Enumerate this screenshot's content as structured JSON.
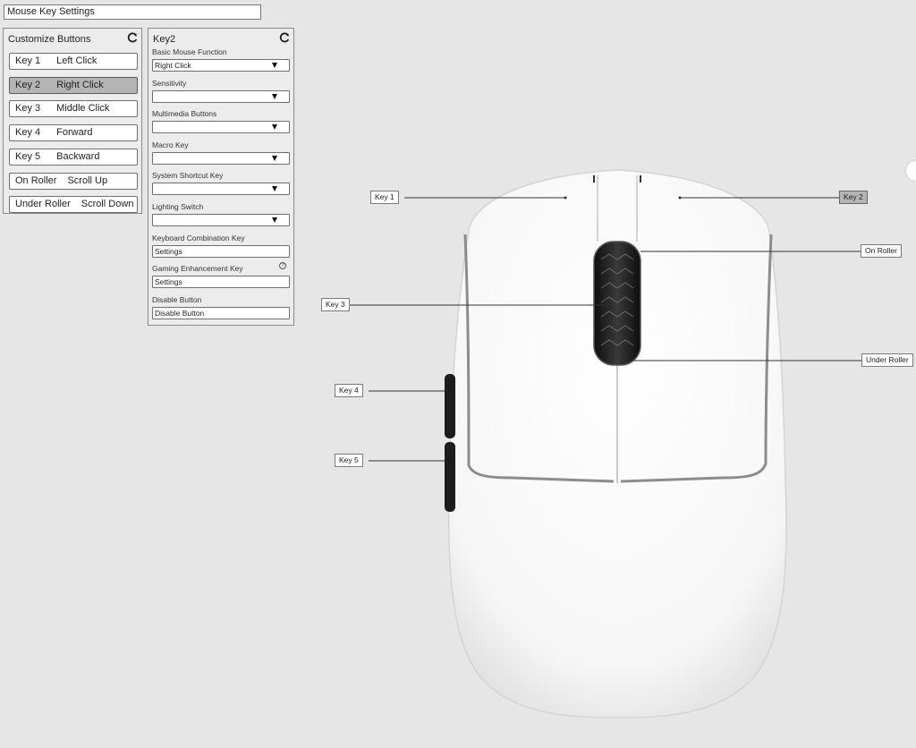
{
  "window": {
    "title": "Mouse Key Settings"
  },
  "customize": {
    "title": "Customize Buttons",
    "buttons": [
      {
        "key": "Key 1",
        "function": "Left Click",
        "active": false
      },
      {
        "key": "Key 2",
        "function": "Right Click",
        "active": true
      },
      {
        "key": "Key 3",
        "function": "Middle Click",
        "active": false
      },
      {
        "key": "Key 4",
        "function": "Forward",
        "active": false
      },
      {
        "key": "Key 5",
        "function": "Backward",
        "active": false
      },
      {
        "key": "On Roller",
        "function": "Scroll Up",
        "active": false
      },
      {
        "key": "Under Roller",
        "function": "Scroll Down",
        "active": false
      }
    ]
  },
  "detail": {
    "title": "Key2",
    "fields": [
      {
        "label": "Basic Mouse Function",
        "value": "Right Click",
        "type": "dropdown"
      },
      {
        "label": "Sensitivity",
        "value": "",
        "type": "dropdown"
      },
      {
        "label": "Multimedia Buttons",
        "value": "",
        "type": "dropdown"
      },
      {
        "label": "Macro Key",
        "value": "",
        "type": "dropdown"
      },
      {
        "label": "System Shortcut Key",
        "value": "",
        "type": "dropdown"
      },
      {
        "label": "Lighting Switch",
        "value": "",
        "type": "dropdown"
      },
      {
        "label": "Keyboard Combination Key",
        "value": "Settings",
        "type": "button"
      },
      {
        "label": "Gaming Enhancement Key",
        "value": "Settings",
        "type": "button"
      },
      {
        "label": "Disable Button",
        "value": "Disable Button",
        "type": "button"
      }
    ]
  },
  "diagram": {
    "labels": {
      "key1": "Key 1",
      "key2": "Key 2",
      "key3": "Key 3",
      "key4": "Key 4",
      "key5": "Key 5",
      "on_roller": "On Roller",
      "under_roller": "Under Roller"
    },
    "selected": "key2"
  },
  "icons": {
    "refresh": "refresh-icon",
    "dropdown": "triangle-down-icon",
    "help": "question-circle-icon"
  },
  "colors": {
    "background": "#e6e6e6",
    "selected": "#b4b4b4",
    "mouse_body": "#ffffff",
    "wheel": "#1a1a1a"
  }
}
